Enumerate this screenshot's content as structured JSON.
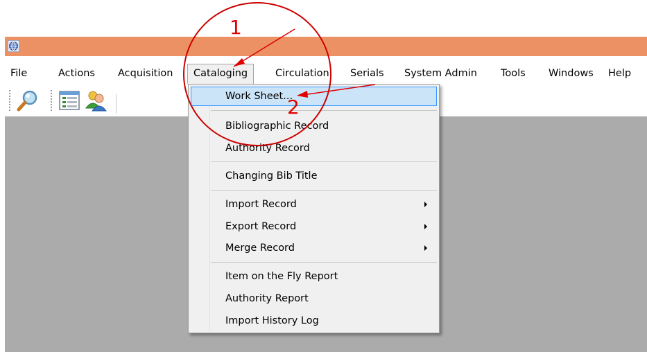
{
  "titlebar": {
    "icon": "globe-app-icon",
    "color": "#ec9163"
  },
  "menubar": {
    "items": [
      {
        "label": "File"
      },
      {
        "label": "Actions"
      },
      {
        "label": "Acquisition"
      },
      {
        "label": "Cataloging",
        "open": true
      },
      {
        "label": "Circulation"
      },
      {
        "label": "Serials"
      },
      {
        "label": "System Admin"
      },
      {
        "label": "Tools"
      },
      {
        "label": "Windows"
      },
      {
        "label": "Help"
      }
    ]
  },
  "toolbar": {
    "buttons": [
      {
        "icon": "magnifier-icon"
      },
      {
        "icon": "form-window-icon"
      },
      {
        "icon": "users-icon"
      }
    ]
  },
  "cataloging_menu": {
    "items": [
      {
        "label": "Work Sheet...",
        "highlighted": true
      },
      {
        "label": "Bibliographic Record"
      },
      {
        "label": "Authority Record"
      },
      {
        "label": "Changing Bib Title"
      },
      {
        "label": "Import Record",
        "submenu": true
      },
      {
        "label": "Export Record",
        "submenu": true
      },
      {
        "label": "Merge Record",
        "submenu": true
      },
      {
        "label": "Item on the Fly Report"
      },
      {
        "label": "Authority Report"
      },
      {
        "label": "Import History Log"
      }
    ]
  },
  "annotations": {
    "step1": "1",
    "step2": "2",
    "color": "#e00000"
  }
}
